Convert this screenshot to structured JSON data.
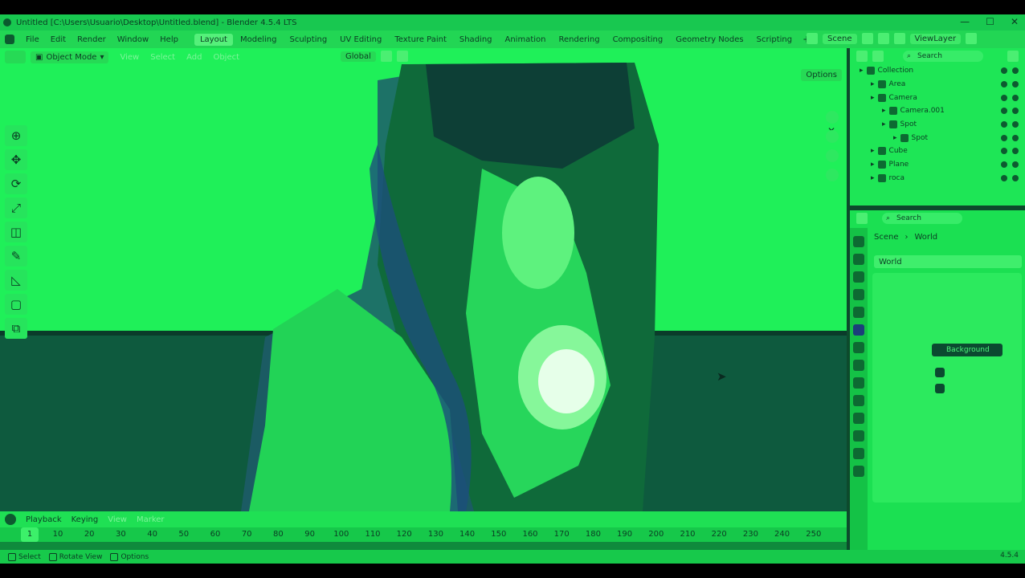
{
  "titlebar": {
    "title": "Untitled [C:\\Users\\Usuario\\Desktop\\Untitled.blend] - Blender 4.5.4 LTS",
    "controls": [
      "—",
      "☐",
      "✕"
    ]
  },
  "menubar": {
    "items": [
      "File",
      "Edit",
      "Render",
      "Window",
      "Help"
    ],
    "workspaces": [
      "Layout",
      "Modeling",
      "Sculpting",
      "UV Editing",
      "Texture Paint",
      "Shading",
      "Animation",
      "Rendering",
      "Compositing",
      "Geometry Nodes",
      "Scripting"
    ],
    "active_workspace": "Layout",
    "add_tab": "+",
    "scene": "Scene",
    "view_layer": "ViewLayer"
  },
  "viewport": {
    "mode": "Object Mode",
    "menus": [
      "View",
      "Select",
      "Add",
      "Object"
    ],
    "orientation": "Global",
    "options": "Options",
    "tools": [
      "cursor",
      "move",
      "rotate",
      "scale",
      "transform",
      "annotate",
      "measure",
      "add-cube",
      "add-object"
    ]
  },
  "timeline": {
    "menus": [
      "Playback",
      "Keying",
      "View",
      "Marker"
    ],
    "current_frame": "1",
    "ticks": [
      "10",
      "20",
      "30",
      "40",
      "50",
      "60",
      "70",
      "80",
      "90",
      "100",
      "110",
      "120",
      "130",
      "140",
      "150",
      "160",
      "170",
      "180",
      "190",
      "200",
      "210",
      "220",
      "230",
      "240",
      "250"
    ]
  },
  "statusbar": {
    "items": [
      "Select",
      "Rotate View",
      "Options"
    ],
    "version": "4.5.4"
  },
  "outliner": {
    "search_placeholder": "Search",
    "rows": [
      {
        "label": "Collection",
        "indent": 0
      },
      {
        "label": "Area",
        "indent": 1
      },
      {
        "label": "Camera",
        "indent": 1
      },
      {
        "label": "Camera.001",
        "indent": 2
      },
      {
        "label": "Spot",
        "indent": 2
      },
      {
        "label": "Spot",
        "indent": 3
      },
      {
        "label": "Cube",
        "indent": 1
      },
      {
        "label": "Plane",
        "indent": 1
      },
      {
        "label": "roca",
        "indent": 1
      }
    ]
  },
  "properties": {
    "search_placeholder": "Search",
    "breadcrumb_scene": "Scene",
    "breadcrumb_world": "World",
    "world_name": "World",
    "surface_shader": "Background"
  }
}
